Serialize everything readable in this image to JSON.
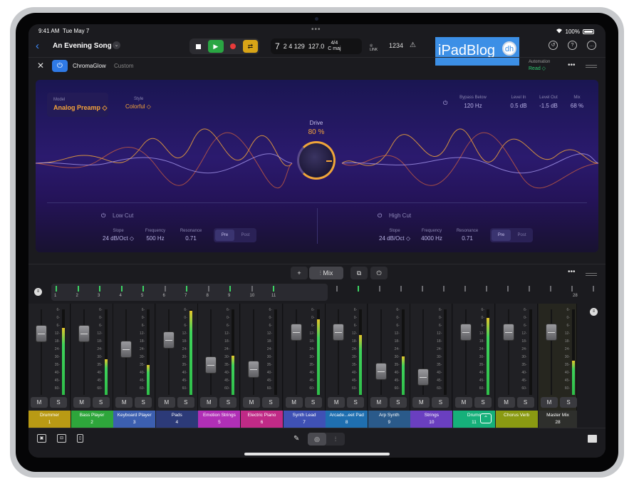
{
  "status": {
    "time": "9:41 AM",
    "date": "Tue May 7",
    "battery": "100%",
    "dots": "•••"
  },
  "topbar": {
    "back": "‹",
    "song_title": "An Evening Song",
    "lcd_bar": "7",
    "lcd_beat": "2 4 129",
    "lcd_tempo": "127.0",
    "lcd_sig": "4/4",
    "lcd_key": "C maj",
    "link": "LINK",
    "count_in": "1234",
    "watermark": "iPadBlog",
    "watermark_badge": "dh"
  },
  "plugin": {
    "name": "ChromaGlow",
    "preset": "Custom",
    "automation_label": "Automation",
    "automation_value": "Read ◇",
    "model_label": "Model",
    "model_value": "Analog Preamp ◇",
    "style_label": "Style",
    "style_value": "Colorful ◇",
    "drive_label": "Drive",
    "drive_value": "80 %",
    "drive_level": 0.8,
    "bypass_label": "Bypass Below",
    "bypass_value": "120 Hz",
    "level_in_label": "Level In",
    "level_in_value": "0.5 dB",
    "level_out_label": "Level Out",
    "level_out_value": "-1.5 dB",
    "mix_label": "Mix",
    "mix_value": "68 %",
    "low_cut": {
      "title": "Low Cut",
      "slope_label": "Slope",
      "slope_value": "24 dB/Oct ◇",
      "freq_label": "Frequency",
      "freq_value": "500 Hz",
      "res_label": "Resonance",
      "res_value": "0.71",
      "pre": "Pre",
      "post": "Post"
    },
    "high_cut": {
      "title": "High Cut",
      "slope_label": "Slope",
      "slope_value": "24 dB/Oct ◇",
      "freq_label": "Frequency",
      "freq_value": "4000 Hz",
      "res_label": "Resonance",
      "res_value": "0.71",
      "pre": "Pre",
      "post": "Post"
    }
  },
  "mixer_header": {
    "add": "+",
    "mix": "Mix",
    "more": "•••"
  },
  "ruler_numbers": [
    "1",
    "2",
    "3",
    "4",
    "5",
    "6",
    "7",
    "8",
    "9",
    "10",
    "11",
    "28"
  ],
  "scale_marks": [
    "6-",
    "0-",
    "6-",
    "12-",
    "18-",
    "24-",
    "30-",
    "35-",
    "40-",
    "45-",
    "60-"
  ],
  "channels": [
    {
      "name": "Drummer",
      "num": "1",
      "color": "#b99a14",
      "fader": 0.8,
      "meter_l": 0.0,
      "meter_r": 0.78
    },
    {
      "name": "Bass Player",
      "num": "2",
      "color": "#2ea63b",
      "fader": 0.8,
      "meter_l": 0.0,
      "meter_r": 0.42
    },
    {
      "name": "Keyboard Player",
      "num": "3",
      "color": "#3c5fb0",
      "fader": 0.6,
      "meter_l": 0.0,
      "meter_r": 0.35
    },
    {
      "name": "Pads",
      "num": "4",
      "color": "#2c3a78",
      "fader": 0.72,
      "meter_l": 0.0,
      "meter_r": 0.98
    },
    {
      "name": "Emotion Strings",
      "num": "5",
      "color": "#b02fb6",
      "fader": 0.4,
      "meter_l": 0.0,
      "meter_r": 0.46
    },
    {
      "name": "Electric Piano",
      "num": "6",
      "color": "#c02a86",
      "fader": 0.35,
      "meter_l": 0.0,
      "meter_r": 0.0
    },
    {
      "name": "Synth Lead",
      "num": "7",
      "color": "#3f51b5",
      "fader": 0.82,
      "meter_l": 0.0,
      "meter_r": 0.88
    },
    {
      "name": "Arcade...eet Pad",
      "num": "8",
      "color": "#1f6fb0",
      "fader": 0.82,
      "meter_l": 0.0,
      "meter_r": 0.7
    },
    {
      "name": "Arp Synth",
      "num": "9",
      "color": "#2a5a8a",
      "fader": 0.32,
      "meter_l": 0.0,
      "meter_r": 0.45
    },
    {
      "name": "Strings",
      "num": "10",
      "color": "#6a3fc0",
      "fader": 0.25,
      "meter_l": 0.0,
      "meter_r": 0.0
    },
    {
      "name": "Drums",
      "num": "11",
      "color": "#16b07a",
      "fader": 0.82,
      "meter_l": 0.0,
      "meter_r": 0.9
    },
    {
      "name": "Chorus Verb",
      "num": "",
      "color": "#8a9a12",
      "fader": 0.82,
      "meter_l": 0.0,
      "meter_r": 0.0
    },
    {
      "name": "Master Mix",
      "num": "28",
      "color": "#2e2f2c",
      "fader": 0.82,
      "meter_l": 0.0,
      "meter_r": 0.4
    }
  ],
  "ms": {
    "mute": "M",
    "solo": "S"
  }
}
